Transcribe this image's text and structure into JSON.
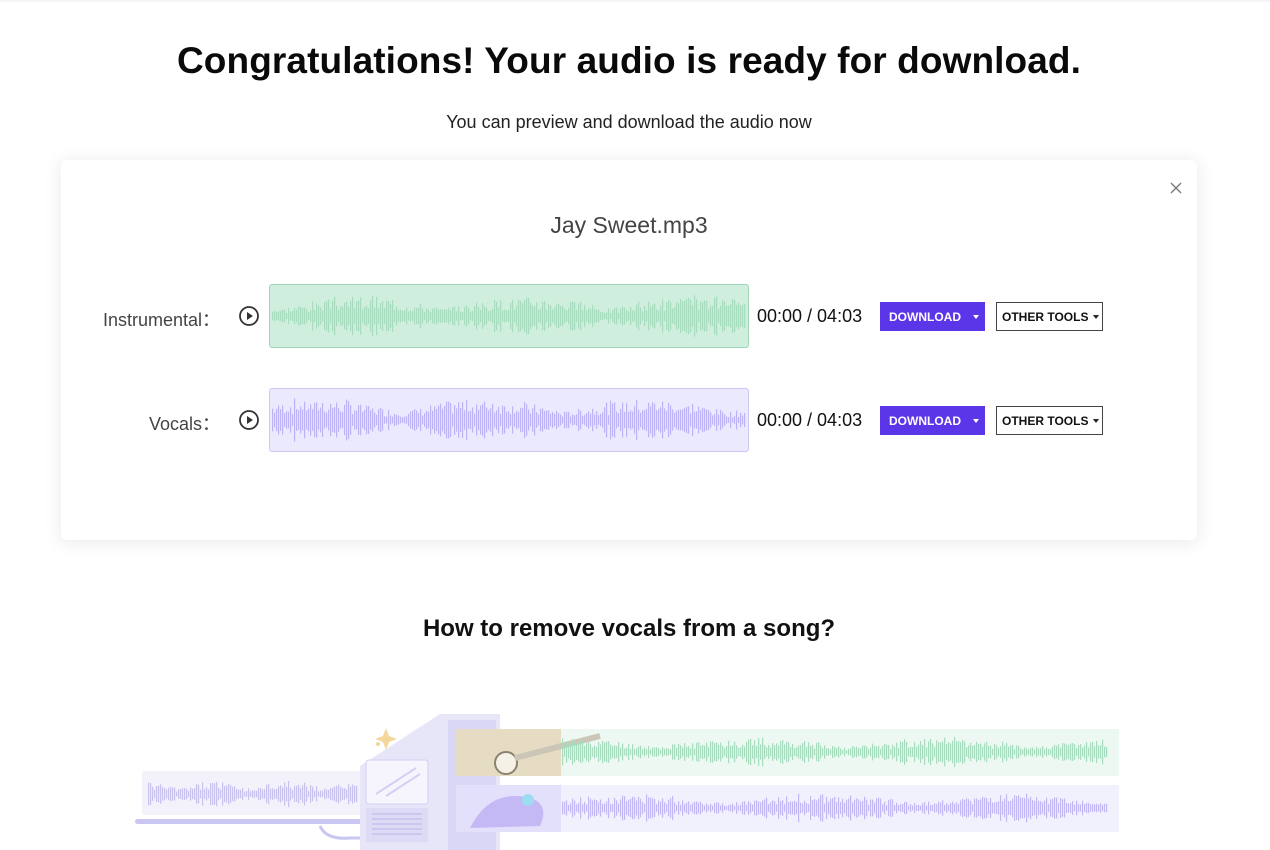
{
  "header": {
    "title": "Congratulations! Your audio is ready for download.",
    "subtitle": "You can preview and download the audio now"
  },
  "card": {
    "filename": "Jay Sweet.mp3",
    "tracks": [
      {
        "label": "Instrumental：",
        "time": "00:00 / 04:03",
        "download_label": "DOWNLOAD",
        "other_tools_label": "OTHER TOOLS",
        "wave_color": "#a8dcbf"
      },
      {
        "label": "Vocals：",
        "time": "00:00 / 04:03",
        "download_label": "DOWNLOAD",
        "other_tools_label": "OTHER TOOLS",
        "wave_color": "#bdb3f7"
      }
    ]
  },
  "howto": {
    "heading": "How to remove vocals from a song?"
  },
  "colors": {
    "accent": "#5b35e8",
    "instrumental_bg": "#cfeedd",
    "vocals_bg": "#ebe9fd"
  },
  "icons": {
    "close": "close-icon",
    "play": "play-circle-icon",
    "dropdown": "caret-down-icon"
  }
}
